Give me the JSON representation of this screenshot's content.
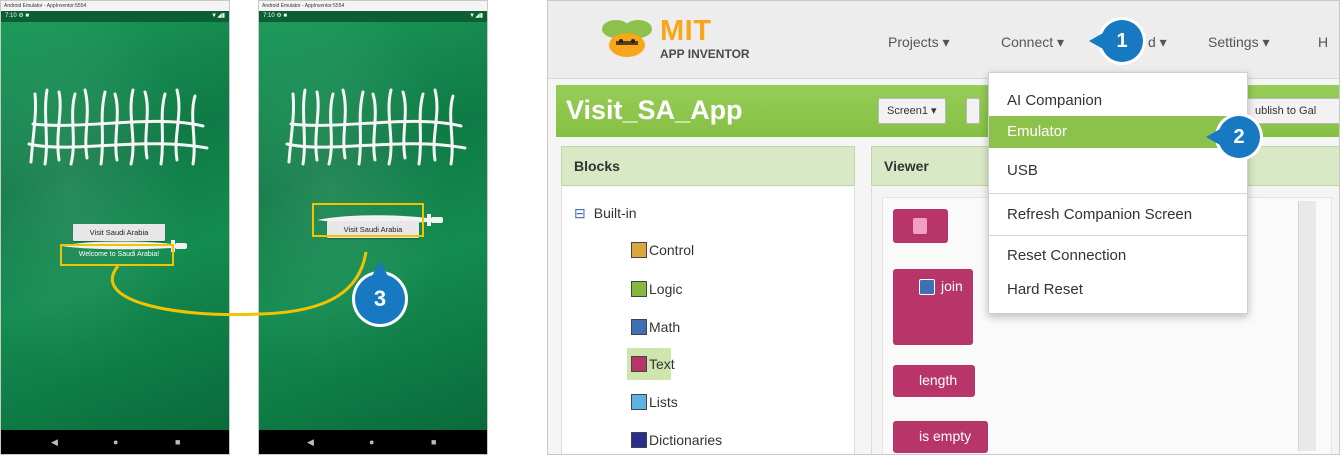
{
  "phones": [
    {
      "window_title": "Android Emulator - AppInventor:5554",
      "status_time": "7:10",
      "status_icons": "⚙ ■",
      "status_right": "▼◢▮",
      "button_label": "Visit Saudi Arabia",
      "welcome_label": "Welcome to Saudi Arabia!"
    },
    {
      "window_title": "Android Emulator - AppInventor:5554",
      "status_time": "7:10",
      "status_icons": "⚙ ■",
      "status_right": "▼◢▮",
      "button_label": "Visit Saudi Arabia"
    }
  ],
  "nav_glyphs": {
    "back": "◀",
    "home": "●",
    "recent": "■"
  },
  "app_inventor": {
    "logo_title": "MIT",
    "logo_subtitle": "APP INVENTOR",
    "nav": [
      "Projects ▾",
      "Connect ▾",
      "d ▾",
      "Settings ▾",
      "H"
    ],
    "project_title": "Visit_SA_App",
    "screen_button": "Screen1 ▾",
    "publish_button": "ublish to Gal",
    "blocks_header": "Blocks",
    "viewer_header": "Viewer",
    "tree_root_toggle": "⊟",
    "tree_root": "Built-in",
    "tree_items": [
      {
        "label": "Control",
        "color": "#d9a63f"
      },
      {
        "label": "Logic",
        "color": "#86b83e"
      },
      {
        "label": "Math",
        "color": "#3f6fb5"
      },
      {
        "label": "Text",
        "color": "#b8356a"
      },
      {
        "label": "Lists",
        "color": "#5ab3e2"
      },
      {
        "label": "Dictionaries",
        "color": "#2a2f8f"
      }
    ],
    "viewer_blocks": [
      "join",
      "length",
      "is empty"
    ],
    "connect_menu": [
      "AI Companion",
      "Emulator",
      "USB",
      "Refresh Companion Screen",
      "Reset Connection",
      "Hard Reset"
    ],
    "selected_menu_item": "Emulator"
  },
  "markers": [
    "1",
    "2",
    "3"
  ],
  "colors": {
    "highlight": "#f2c300",
    "marker": "#1779c2",
    "green_bar": "#8cc24b",
    "text_block": "#b8356a",
    "flag_green": "#0f7a45"
  }
}
